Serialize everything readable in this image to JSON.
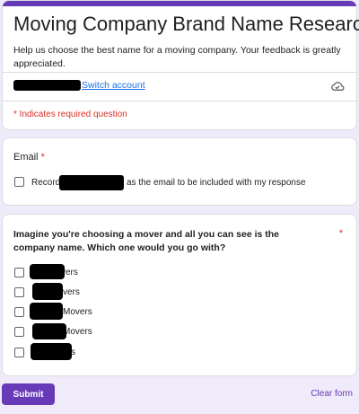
{
  "form": {
    "title": "Moving Company Brand Name Research",
    "description": "Help us choose the best name for a moving company. Your feedback is greatly appreciated.",
    "switch_account_label": "Switch account",
    "required_note": "* Indicates required question",
    "icons": {
      "cloud": "cloud-saved-icon"
    },
    "accent_color": "#673ab7",
    "required_color": "#d93025"
  },
  "email": {
    "label": "Email",
    "asterisk": "*",
    "record_prefix": "Record",
    "record_suffix": "as the email to be included with my response"
  },
  "question": {
    "title": "Imagine you're choosing a mover and all you can see is the company name. Which one would you go with?",
    "asterisk": "*",
    "options": [
      {
        "visible_text": "vers"
      },
      {
        "visible_text": "vers"
      },
      {
        "visible_text": "Movers"
      },
      {
        "visible_text": "Movers"
      },
      {
        "visible_text": "s"
      }
    ]
  },
  "actions": {
    "submit_label": "Submit",
    "clear_label": "Clear form"
  }
}
